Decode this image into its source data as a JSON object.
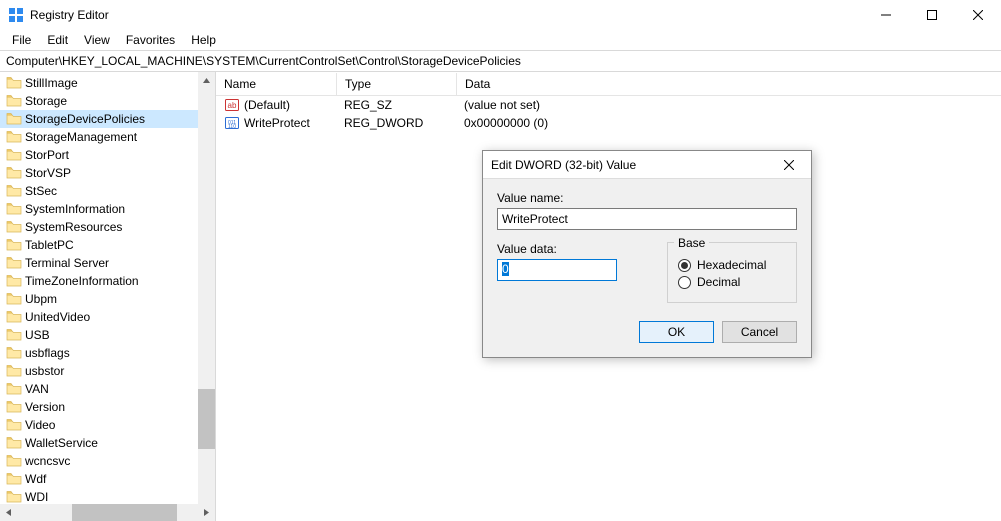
{
  "window": {
    "title": "Registry Editor"
  },
  "menu": {
    "file": "File",
    "edit": "Edit",
    "view": "View",
    "favorites": "Favorites",
    "help": "Help"
  },
  "address": "Computer\\HKEY_LOCAL_MACHINE\\SYSTEM\\CurrentControlSet\\Control\\StorageDevicePolicies",
  "tree": {
    "items": [
      "StillImage",
      "Storage",
      "StorageDevicePolicies",
      "StorageManagement",
      "StorPort",
      "StorVSP",
      "StSec",
      "SystemInformation",
      "SystemResources",
      "TabletPC",
      "Terminal Server",
      "TimeZoneInformation",
      "Ubpm",
      "UnitedVideo",
      "USB",
      "usbflags",
      "usbstor",
      "VAN",
      "Version",
      "Video",
      "WalletService",
      "wcncsvc",
      "Wdf",
      "WDI"
    ],
    "selected_index": 2
  },
  "list": {
    "columns": {
      "name": "Name",
      "type": "Type",
      "data": "Data"
    },
    "rows": [
      {
        "icon": "string",
        "name": "(Default)",
        "type": "REG_SZ",
        "data": "(value not set)"
      },
      {
        "icon": "binary",
        "name": "WriteProtect",
        "type": "REG_DWORD",
        "data": "0x00000000 (0)"
      }
    ]
  },
  "dialog": {
    "title": "Edit DWORD (32-bit) Value",
    "value_name_label": "Value name:",
    "value_name": "WriteProtect",
    "value_data_label": "Value data:",
    "value_data": "0",
    "base_label": "Base",
    "hex_label": "Hexadecimal",
    "dec_label": "Decimal",
    "base_selected": "hex",
    "ok": "OK",
    "cancel": "Cancel"
  }
}
